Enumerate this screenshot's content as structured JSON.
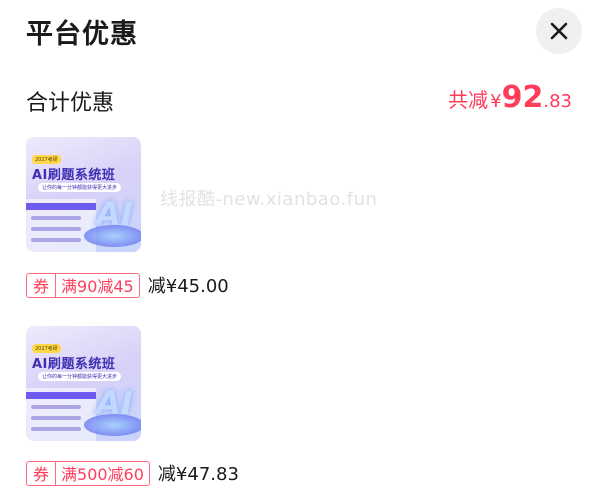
{
  "header": {
    "title": "平台优惠",
    "close_icon": "close-icon"
  },
  "summary": {
    "label": "合计优惠",
    "prefix": "共减",
    "currency": "¥",
    "amount_int": "92",
    "amount_dec": ".83",
    "accent": "#ff3d5a"
  },
  "watermark": "线报酷-new.xianbao.fun",
  "items": [
    {
      "thumb": {
        "year": "2027考研",
        "title": "AI刷题系统班",
        "sub": "让你的每一分钟都能获得更大进步",
        "ai": "AI"
      },
      "coupon": {
        "type": "券",
        "rule": "满90减45",
        "amount": "减¥45.00"
      }
    },
    {
      "thumb": {
        "year": "2027考研",
        "title": "AI刷题系统班",
        "sub": "让你的每一分钟都能获得更大进步",
        "ai": "AI"
      },
      "coupon": {
        "type": "券",
        "rule": "满500减60",
        "amount": "减¥47.83"
      }
    }
  ]
}
